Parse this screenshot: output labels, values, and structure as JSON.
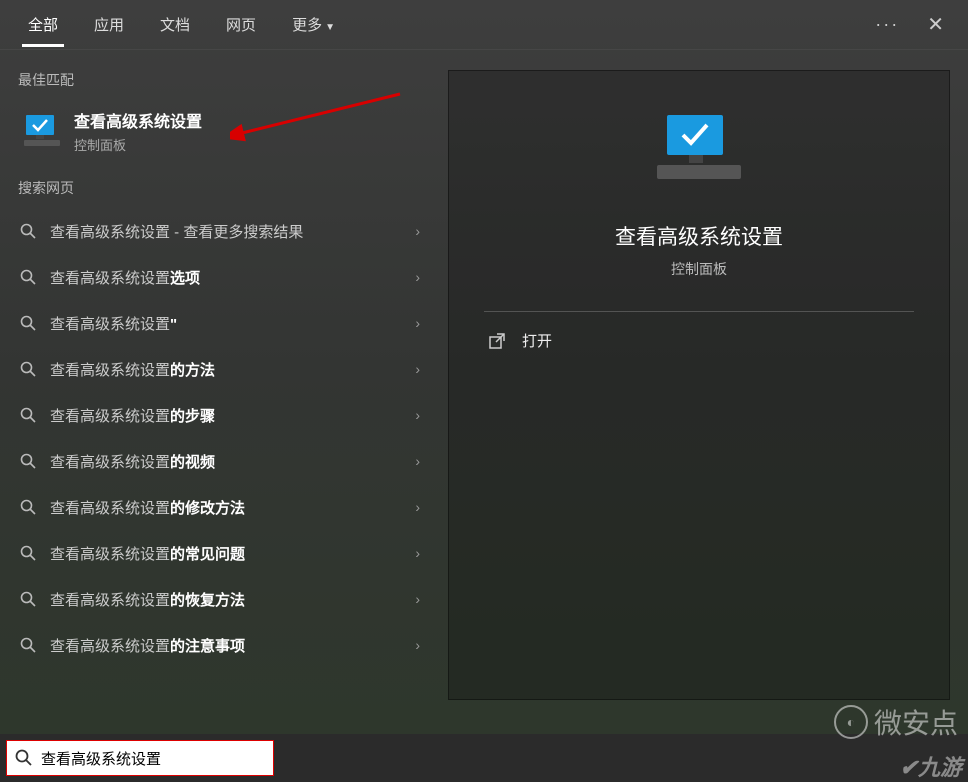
{
  "tabs": {
    "all": "全部",
    "apps": "应用",
    "docs": "文档",
    "web": "网页",
    "more": "更多"
  },
  "sections": {
    "best_match": "最佳匹配",
    "web_search": "搜索网页"
  },
  "best_match": {
    "title": "查看高级系统设置",
    "subtitle": "控制面板"
  },
  "web_results": [
    {
      "prefix": "查看高级系统设置",
      "suffix": "",
      "tail": " - 查看更多搜索结果"
    },
    {
      "prefix": "查看高级系统设置",
      "suffix": "选项",
      "tail": ""
    },
    {
      "prefix": "查看高级系统设置",
      "suffix": "\"",
      "tail": ""
    },
    {
      "prefix": "查看高级系统设置",
      "suffix": "的方法",
      "tail": ""
    },
    {
      "prefix": "查看高级系统设置",
      "suffix": "的步骤",
      "tail": ""
    },
    {
      "prefix": "查看高级系统设置",
      "suffix": "的视频",
      "tail": ""
    },
    {
      "prefix": "查看高级系统设置",
      "suffix": "的修改方法",
      "tail": ""
    },
    {
      "prefix": "查看高级系统设置",
      "suffix": "的常见问题",
      "tail": ""
    },
    {
      "prefix": "查看高级系统设置",
      "suffix": "的恢复方法",
      "tail": ""
    },
    {
      "prefix": "查看高级系统设置",
      "suffix": "的注意事项",
      "tail": ""
    }
  ],
  "preview": {
    "title": "查看高级系统设置",
    "subtitle": "控制面板",
    "open": "打开"
  },
  "search": {
    "value": "查看高级系统设置"
  },
  "watermark": {
    "text1": "微安点",
    "text2": "九游"
  }
}
